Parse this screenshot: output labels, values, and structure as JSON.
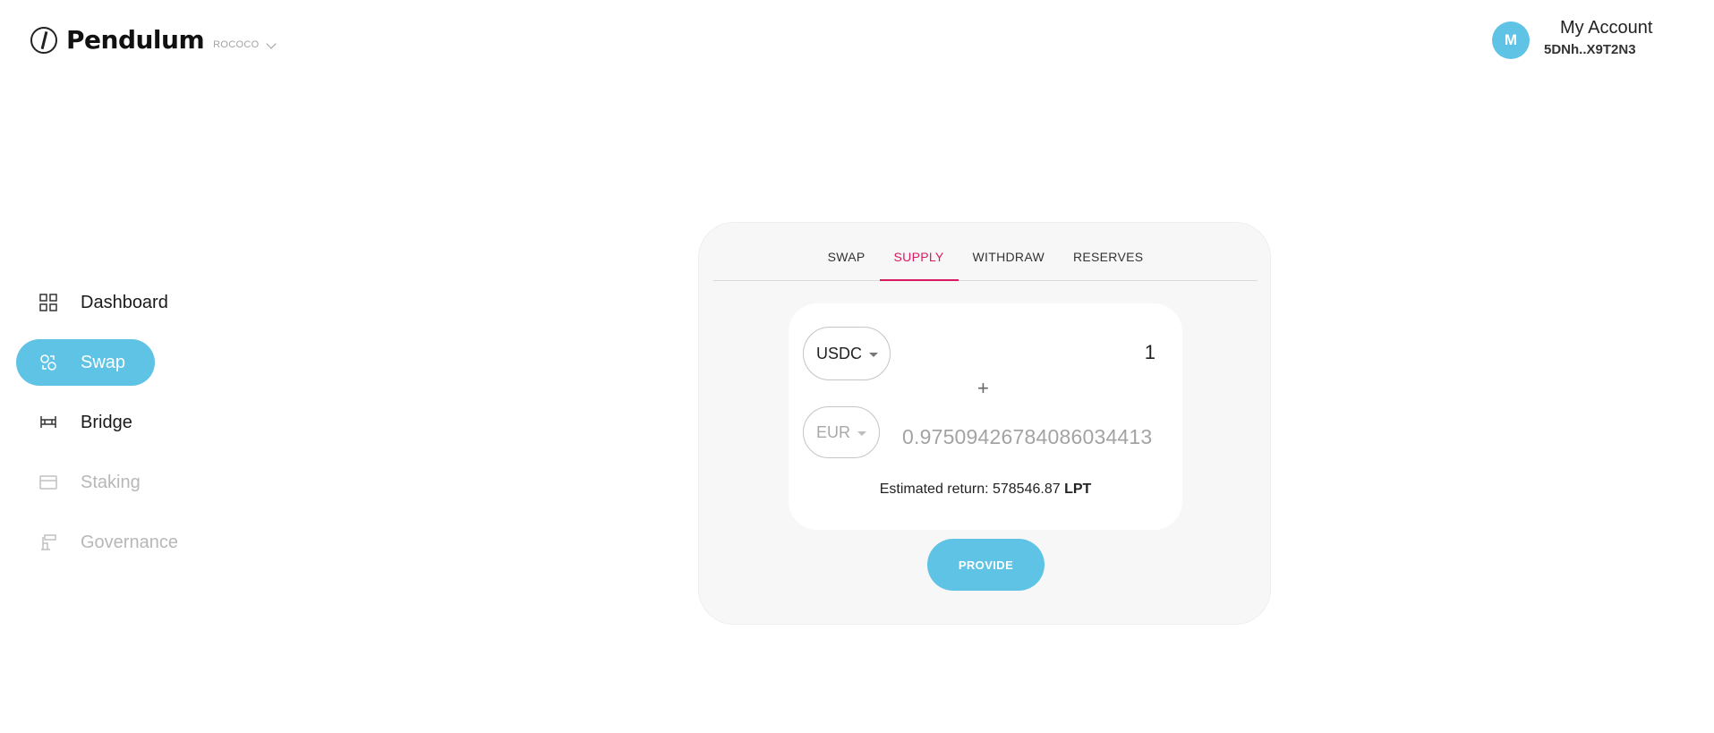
{
  "header": {
    "brand": "Pendulum",
    "network": "ROCOCO",
    "account_initial": "M",
    "account_label": "My Account",
    "account_address": "5DNh..X9T2N3"
  },
  "sidebar": {
    "items": [
      {
        "label": "Dashboard",
        "icon": "grid-icon",
        "state": "normal"
      },
      {
        "label": "Swap",
        "icon": "swap-icon",
        "state": "active"
      },
      {
        "label": "Bridge",
        "icon": "bridge-icon",
        "state": "normal"
      },
      {
        "label": "Staking",
        "icon": "staking-icon",
        "state": "disabled"
      },
      {
        "label": "Governance",
        "icon": "governance-icon",
        "state": "disabled"
      }
    ]
  },
  "card": {
    "tabs": [
      {
        "label": "SWAP"
      },
      {
        "label": "SUPPLY"
      },
      {
        "label": "WITHDRAW"
      },
      {
        "label": "RESERVES"
      }
    ],
    "active_tab": "SUPPLY",
    "token_a": {
      "symbol": "USDC",
      "amount": "1"
    },
    "plus": "+",
    "token_b": {
      "symbol": "EUR",
      "amount": "0.9750942678408603441​3"
    },
    "estimate_prefix": "Estimated return: 578546.87 ",
    "estimate_unit": "LPT",
    "provide_label": "PROVIDE"
  },
  "colors": {
    "accent": "#5ec3e5",
    "tab_active": "#d81b60",
    "card_bg": "#f7f7f7"
  }
}
